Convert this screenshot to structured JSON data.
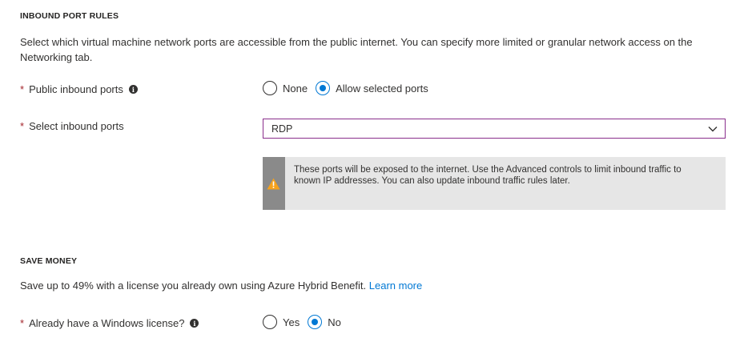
{
  "inbound": {
    "header": "INBOUND PORT RULES",
    "description": "Select which virtual machine network ports are accessible from the public internet. You can specify more limited or granular network access on the Networking tab.",
    "public_ports": {
      "label": "Public inbound ports",
      "required_mark": "*",
      "options": [
        {
          "label": "None",
          "checked": false
        },
        {
          "label": "Allow selected ports",
          "checked": true
        }
      ]
    },
    "select_ports": {
      "label": "Select inbound ports",
      "required_mark": "*",
      "value": "RDP"
    },
    "warning": "These ports will be exposed to the internet. Use the Advanced controls to limit inbound traffic to known IP addresses. You can also update inbound traffic rules later."
  },
  "save_money": {
    "header": "SAVE MONEY",
    "description": "Save up to 49% with a license you already own using Azure Hybrid Benefit.",
    "link": "Learn more",
    "license": {
      "label": "Already have a Windows license?",
      "required_mark": "*",
      "options": [
        {
          "label": "Yes",
          "checked": false
        },
        {
          "label": "No",
          "checked": true
        }
      ]
    }
  },
  "colors": {
    "accent": "#0078d4",
    "required": "#a4262c",
    "dropdown_border": "#8a2e8c",
    "warning_bg": "#e6e6e6",
    "warning_icon": "#f7a21b"
  },
  "icons": {
    "info": "info-icon",
    "warning": "warning-icon",
    "chevron": "chevron-down-icon"
  }
}
